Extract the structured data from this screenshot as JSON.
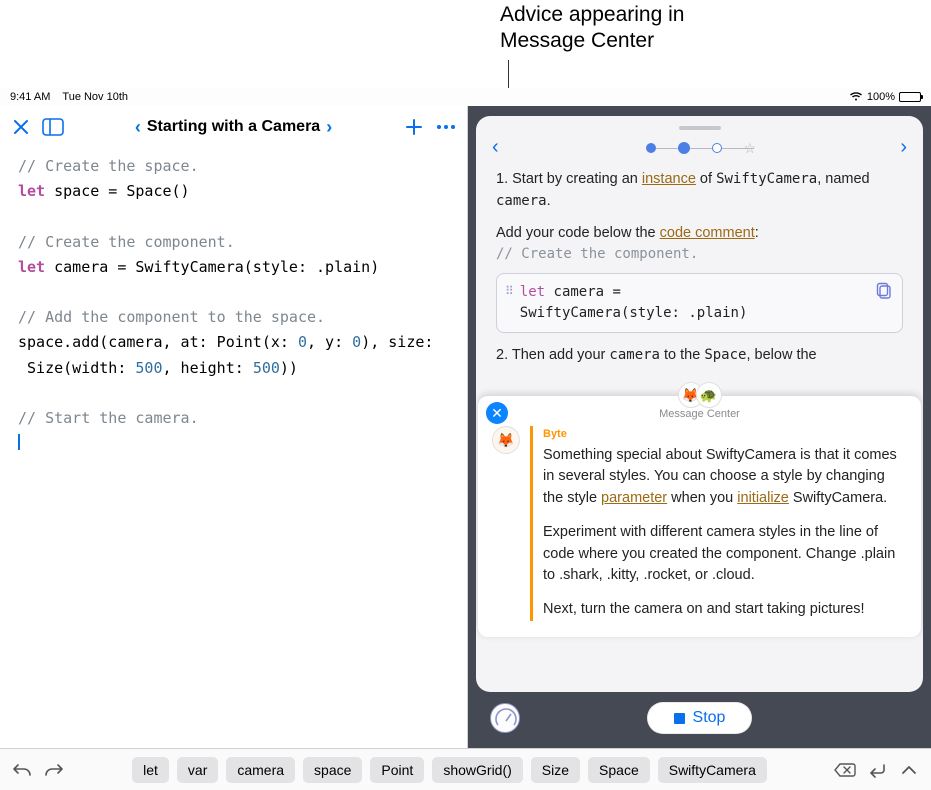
{
  "annotation": {
    "line1": "Advice appearing in",
    "line2": "Message Center"
  },
  "statusbar": {
    "time": "9:41 AM",
    "date": "Tue Nov 10th",
    "battery_pct": "100%"
  },
  "editor": {
    "breadcrumb_title": "Starting with a Camera",
    "code": {
      "l1": "// Create the space.",
      "l2a": "let",
      "l2b": " space = Space()",
      "l3": "",
      "l4": "// Create the component.",
      "l5a": "let",
      "l5b": " camera = SwiftyCamera(style: .plain)",
      "l6": "",
      "l7": "// Add the component to the space.",
      "l8a": "space.add(camera, at: Point(x: ",
      "l8n1": "0",
      "l8b": ", y: ",
      "l8n2": "0",
      "l8c": "), size:",
      "l9a": " Size(width: ",
      "l9n1": "500",
      "l9b": ", height: ",
      "l9n2": "500",
      "l9c": "))",
      "l10": "",
      "l11": "// Start the camera."
    }
  },
  "instructions": {
    "step1_a": "1. Start by creating an ",
    "step1_link": "instance",
    "step1_b": " of ",
    "step1_c": "SwiftyCamera",
    "step1_d": ", named ",
    "step1_e": "camera",
    "step1_f": ".",
    "add_a": "Add your code below the ",
    "add_link": "code comment",
    "add_b": ":",
    "comment_gray": "// Create the component.",
    "codeblock_kw": "let",
    "codeblock_rest1": " camera =",
    "codeblock_rest2": "  SwiftyCamera(style: .plain)",
    "step2_a": "2. Then add your ",
    "step2_b": "camera",
    "step2_c": " to the ",
    "step2_d": "Space",
    "step2_e": ", below the"
  },
  "message_center": {
    "header": "Message Center",
    "from": "Byte",
    "p1_a": "Something special about ",
    "p1_mono": "SwiftyCamera",
    "p1_b": " is that it comes in several styles. You can choose a style by changing the ",
    "p1_mono2": "style",
    "p1_c": " ",
    "p1_link1": "parameter",
    "p1_d": " when you ",
    "p1_link2": "initialize",
    "p1_e": " ",
    "p1_mono3": "SwiftyCamera",
    "p1_f": ".",
    "p2_a": "Experiment with different camera styles in the line of code where you created the component. Change ",
    "p2_m1": ".plain",
    "p2_b": " to ",
    "p2_m2": ".shark",
    "p2_c": ", ",
    "p2_m3": ".kitty",
    "p2_d": ", ",
    "p2_m4": ".rocket",
    "p2_e": ", or ",
    "p2_m5": ".cloud",
    "p2_f": ".",
    "p3": "Next, turn the camera on and start taking pictures!"
  },
  "run": {
    "stop_label": "Stop"
  },
  "kbd": {
    "chips": [
      "let",
      "var",
      "camera",
      "space",
      "Point",
      "showGrid()",
      "Size",
      "Space",
      "SwiftyCamera"
    ]
  }
}
